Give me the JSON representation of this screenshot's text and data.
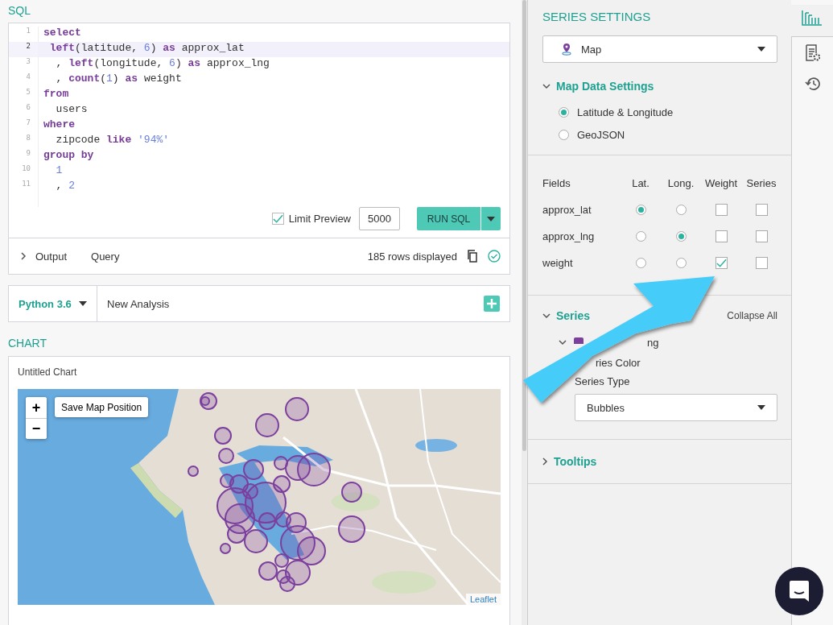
{
  "sql_section": {
    "title": "SQL",
    "lines": [
      {
        "number": "1",
        "active": false,
        "tokens": [
          {
            "kind": "kw",
            "text": "select"
          }
        ]
      },
      {
        "number": "2",
        "active": true,
        "tokens": [
          {
            "kind": "kw",
            "text": " left"
          },
          {
            "kind": "plain",
            "text": "(latitude, "
          },
          {
            "kind": "num",
            "text": "6"
          },
          {
            "kind": "plain",
            "text": ") "
          },
          {
            "kind": "kw",
            "text": "as"
          },
          {
            "kind": "plain",
            "text": " approx_lat"
          }
        ]
      },
      {
        "number": "3",
        "active": false,
        "tokens": [
          {
            "kind": "plain",
            "text": "  , "
          },
          {
            "kind": "kw",
            "text": "left"
          },
          {
            "kind": "plain",
            "text": "(longitude, "
          },
          {
            "kind": "num",
            "text": "6"
          },
          {
            "kind": "plain",
            "text": ") "
          },
          {
            "kind": "kw",
            "text": "as"
          },
          {
            "kind": "plain",
            "text": " approx_lng"
          }
        ]
      },
      {
        "number": "4",
        "active": false,
        "tokens": [
          {
            "kind": "plain",
            "text": "  , "
          },
          {
            "kind": "kw",
            "text": "count"
          },
          {
            "kind": "plain",
            "text": "("
          },
          {
            "kind": "num",
            "text": "1"
          },
          {
            "kind": "plain",
            "text": ") "
          },
          {
            "kind": "kw",
            "text": "as"
          },
          {
            "kind": "plain",
            "text": " weight"
          }
        ]
      },
      {
        "number": "5",
        "active": false,
        "tokens": [
          {
            "kind": "kw",
            "text": "from"
          }
        ]
      },
      {
        "number": "6",
        "active": false,
        "tokens": [
          {
            "kind": "plain",
            "text": "  users"
          }
        ]
      },
      {
        "number": "7",
        "active": false,
        "tokens": [
          {
            "kind": "kw",
            "text": "where"
          }
        ]
      },
      {
        "number": "8",
        "active": false,
        "tokens": [
          {
            "kind": "plain",
            "text": "  zipcode "
          },
          {
            "kind": "kw",
            "text": "like"
          },
          {
            "kind": "str",
            "text": " '94%'"
          }
        ]
      },
      {
        "number": "9",
        "active": false,
        "tokens": [
          {
            "kind": "kw",
            "text": "group by"
          }
        ]
      },
      {
        "number": "10",
        "active": false,
        "tokens": [
          {
            "kind": "num",
            "text": "  1"
          }
        ]
      },
      {
        "number": "11",
        "active": false,
        "tokens": [
          {
            "kind": "plain",
            "text": "  , "
          },
          {
            "kind": "num",
            "text": "2"
          }
        ]
      }
    ],
    "limit_preview": {
      "label": "Limit Preview",
      "checked": true
    },
    "limit_value": "5000",
    "run_button": "RUN SQL",
    "output_tab": {
      "label": "Output",
      "expanded": false
    },
    "query_tab": "Query",
    "rows_status": "185 rows displayed"
  },
  "analysis": {
    "language": "Python 3.6",
    "name": "New Analysis"
  },
  "chart_section": {
    "title": "CHART",
    "chart_title": "Untitled Chart",
    "map": {
      "kind": "picture",
      "zoom_in": "+",
      "zoom_out": "−",
      "save_button": "Save Map Position",
      "attribution": "Leaflet"
    }
  },
  "series_settings": {
    "title": "SERIES SETTINGS",
    "chart_type": "Map",
    "map_data_settings": {
      "title": "Map Data Settings",
      "expanded": true,
      "options": [
        {
          "label": "Latitude & Longitude",
          "selected": true
        },
        {
          "label": "GeoJSON",
          "selected": false
        }
      ]
    },
    "fields": {
      "columns": [
        "Fields",
        "Lat.",
        "Long.",
        "Weight",
        "Series"
      ],
      "rows": [
        {
          "name": "approx_lat",
          "lat": true,
          "long": false,
          "weight_checked": false,
          "series_checked": false
        },
        {
          "name": "approx_lng",
          "lat": false,
          "long": true,
          "weight_checked": false,
          "series_checked": false
        },
        {
          "name": "weight",
          "lat": false,
          "long": false,
          "weight_checked": true,
          "series_checked": false
        }
      ]
    },
    "series": {
      "title": "Series",
      "expanded": true,
      "collapse_all": "Collapse All",
      "item": {
        "name": "ng",
        "expanded": true,
        "color": "#7b3f9e"
      },
      "color_label": "ries Color",
      "type_label": "Series Type",
      "type_value": "Bubbles"
    },
    "tooltips": {
      "title": "Tooltips",
      "expanded": false
    }
  },
  "rail": [
    {
      "kind": "chart",
      "selected": true
    },
    {
      "kind": "report",
      "selected": false
    },
    {
      "kind": "history",
      "selected": false
    }
  ]
}
